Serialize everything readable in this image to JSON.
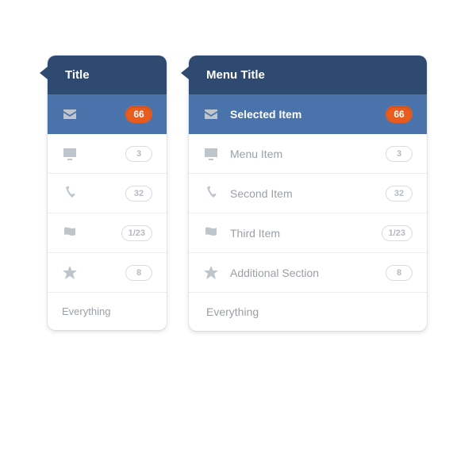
{
  "colors": {
    "header_bg": "#2f4a70",
    "selected_bg": "#4973aa",
    "badge_selected_bg": "#e85d1f",
    "text_muted": "#9aa0a6",
    "badge_border": "#d9dde1"
  },
  "narrow_panel": {
    "title": "Title",
    "items": [
      {
        "icon": "mail-icon",
        "badge": "66",
        "selected": true
      },
      {
        "icon": "monitor-icon",
        "badge": "3",
        "selected": false
      },
      {
        "icon": "phone-icon",
        "badge": "32",
        "selected": false
      },
      {
        "icon": "flag-icon",
        "badge": "1/23",
        "selected": false
      },
      {
        "icon": "star-icon",
        "badge": "8",
        "selected": false
      }
    ],
    "footer": "Everything"
  },
  "wide_panel": {
    "title": "Menu Title",
    "items": [
      {
        "icon": "mail-icon",
        "label": "Selected Item",
        "badge": "66",
        "selected": true
      },
      {
        "icon": "monitor-icon",
        "label": "Menu Item",
        "badge": "3",
        "selected": false
      },
      {
        "icon": "phone-icon",
        "label": "Second Item",
        "badge": "32",
        "selected": false
      },
      {
        "icon": "flag-icon",
        "label": "Third Item",
        "badge": "1/23",
        "selected": false
      },
      {
        "icon": "star-icon",
        "label": "Additional Section",
        "badge": "8",
        "selected": false
      }
    ],
    "footer": "Everything"
  }
}
